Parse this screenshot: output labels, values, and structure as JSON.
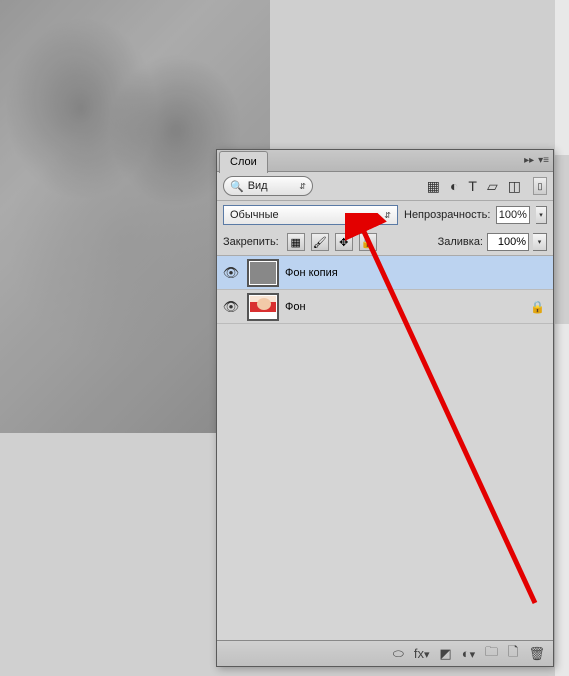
{
  "panel": {
    "tab_title": "Слои",
    "search_label": "Вид",
    "blend_mode": "Обычные",
    "opacity_label": "Непрозрачность:",
    "opacity_value": "100%",
    "lock_label": "Закрепить:",
    "fill_label": "Заливка:",
    "fill_value": "100%",
    "layers": [
      {
        "name": "Фон копия",
        "selected": true,
        "locked": false
      },
      {
        "name": "Фон",
        "selected": false,
        "locked": true
      }
    ]
  }
}
